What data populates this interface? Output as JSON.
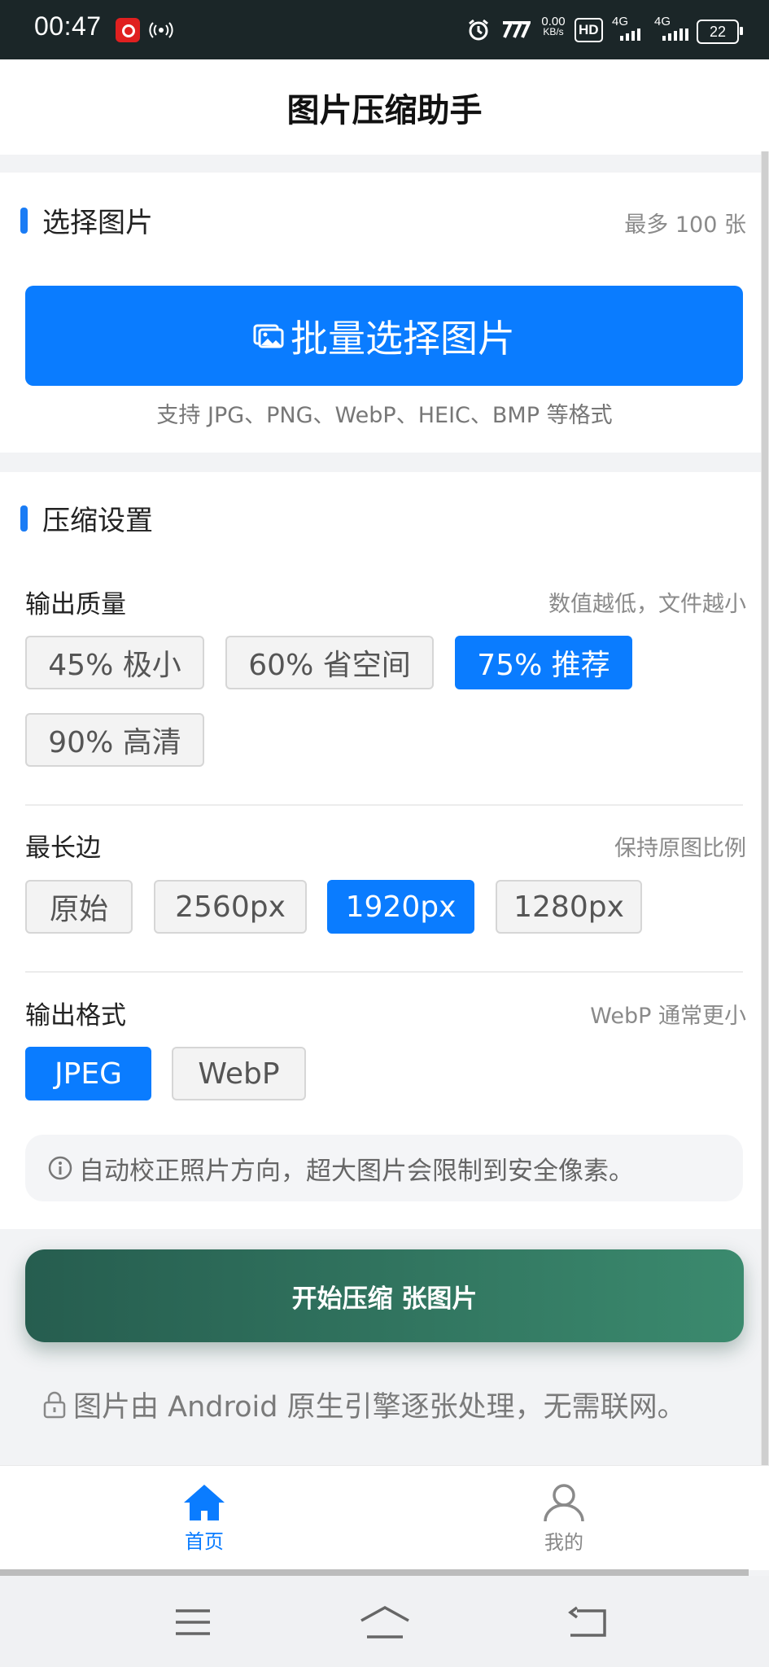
{
  "status_bar": {
    "time": "00:47",
    "net_speed_value": "0.00",
    "net_speed_unit": "KB/s",
    "hd_label": "HD",
    "sim1_type": "4G",
    "sim2_type": "4G",
    "battery": "22"
  },
  "header": {
    "title": "图片压缩助手"
  },
  "select_section": {
    "title": "选择图片",
    "limit_hint": "最多 100 张",
    "select_button_label": "批量选择图片",
    "formats_note": "支持 JPG、PNG、WebP、HEIC、BMP 等格式"
  },
  "settings_section": {
    "title": "压缩设置",
    "quality": {
      "label": "输出质量",
      "hint": "数值越低，文件越小",
      "options": [
        "45% 极小",
        "60% 省空间",
        "75% 推荐",
        "90% 高清"
      ],
      "selected": "75% 推荐"
    },
    "max_side": {
      "label": "最长边",
      "hint": "保持原图比例",
      "options": [
        "原始",
        "2560px",
        "1920px",
        "1280px"
      ],
      "selected": "1920px"
    },
    "format": {
      "label": "输出格式",
      "hint": "WebP 通常更小",
      "options": [
        "JPEG",
        "WebP"
      ],
      "selected": "JPEG"
    },
    "info_text": "自动校正照片方向，超大图片会限制到安全像素。"
  },
  "start_button_label": "开始压缩 张图片",
  "privacy_note": "图片由 Android 原生引擎逐张处理，无需联网。",
  "tabs": [
    {
      "label": "首页",
      "icon": "home-icon",
      "active": true
    },
    {
      "label": "我的",
      "icon": "user-icon",
      "active": false
    }
  ],
  "colors": {
    "accent": "#0a7cff",
    "start_gradient_from": "#265d4f",
    "start_gradient_to": "#3b8a6e"
  }
}
